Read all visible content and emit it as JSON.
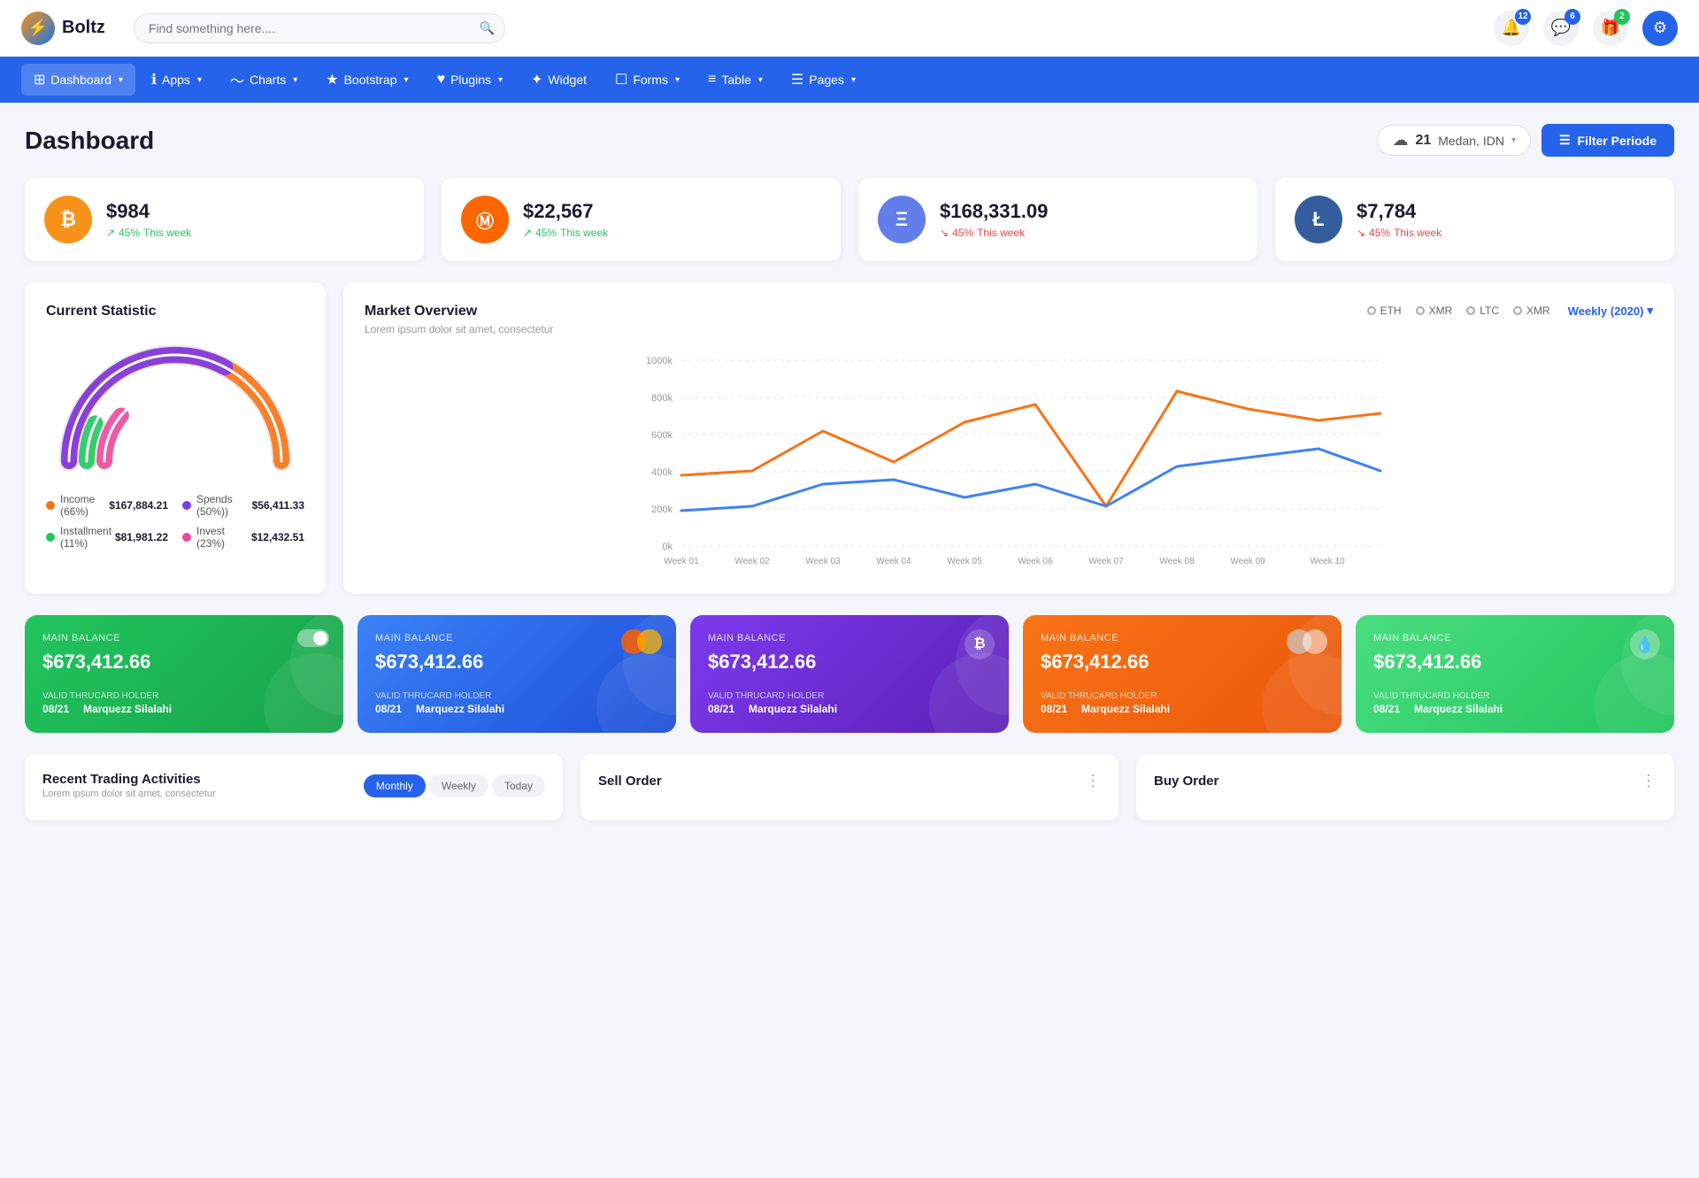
{
  "logo": {
    "text": "Boltz",
    "icon": "⚡"
  },
  "search": {
    "placeholder": "Find something here...."
  },
  "notifications": {
    "bell_count": "12",
    "message_count": "6",
    "gift_count": "2"
  },
  "nav": {
    "items": [
      {
        "id": "dashboard",
        "label": "Dashboard",
        "icon": "⊞",
        "hasArrow": true,
        "active": true
      },
      {
        "id": "apps",
        "label": "Apps",
        "icon": "ℹ",
        "hasArrow": true
      },
      {
        "id": "charts",
        "label": "Charts",
        "icon": "〜",
        "hasArrow": true
      },
      {
        "id": "bootstrap",
        "label": "Bootstrap",
        "icon": "★",
        "hasArrow": true
      },
      {
        "id": "plugins",
        "label": "Plugins",
        "icon": "♥",
        "hasArrow": true
      },
      {
        "id": "widget",
        "label": "Widget",
        "icon": "✦",
        "hasArrow": false
      },
      {
        "id": "forms",
        "label": "Forms",
        "icon": "☐",
        "hasArrow": true
      },
      {
        "id": "table",
        "label": "Table",
        "icon": "≡",
        "hasArrow": true
      },
      {
        "id": "pages",
        "label": "Pages",
        "icon": "☰",
        "hasArrow": true
      }
    ]
  },
  "dashboard": {
    "title": "Dashboard",
    "weather": {
      "icon": "☁",
      "temp": "21",
      "location": "Medan, IDN"
    },
    "filter_btn": "Filter Periode"
  },
  "stat_cards": [
    {
      "id": "btc",
      "icon": "₿",
      "icon_class": "btc",
      "value": "$984",
      "change": "45%",
      "period": "This week",
      "direction": "up"
    },
    {
      "id": "mono",
      "icon": "Ⓜ",
      "icon_class": "mono",
      "value": "$22,567",
      "change": "45%",
      "period": "This week",
      "direction": "up"
    },
    {
      "id": "eth",
      "icon": "Ξ",
      "icon_class": "eth",
      "value": "$168,331.09",
      "change": "45%",
      "period": "This week",
      "direction": "down"
    },
    {
      "id": "ltc",
      "icon": "Ł",
      "icon_class": "ltc",
      "value": "$7,784",
      "change": "45%",
      "period": "This week",
      "direction": "down"
    }
  ],
  "current_statistic": {
    "title": "Current Statistic",
    "legend": [
      {
        "color": "#f97316",
        "label": "Income (66%)",
        "value": "$167,884.21"
      },
      {
        "color": "#7c3aed",
        "label": "Spends (50%))",
        "value": "$56,411.33"
      },
      {
        "color": "#22c55e",
        "label": "Installment (11%)",
        "value": "$81,981.22"
      },
      {
        "color": "#ec4899",
        "label": "Invest (23%)",
        "value": "$12,432.51"
      }
    ]
  },
  "market_overview": {
    "title": "Market Overview",
    "subtitle": "Lorem ipsum dolor sit amet, consectetur",
    "legends": [
      "ETH",
      "XMR",
      "LTC",
      "XMR"
    ],
    "weekly_label": "Weekly (2020)",
    "y_labels": [
      "1000k",
      "800k",
      "600k",
      "400k",
      "200k",
      "0k"
    ],
    "x_labels": [
      "Week 01",
      "Week 02",
      "Week 03",
      "Week 04",
      "Week 05",
      "Week 06",
      "Week 07",
      "Week 08",
      "Week 09",
      "Week 10"
    ]
  },
  "balance_cards": [
    {
      "color_class": "green",
      "label": "Main Balance",
      "amount": "$673,412.66",
      "valid_label": "VALID THRUCARD HOLDER",
      "date": "08/21",
      "holder": "Marquezz Silalahi",
      "icon_type": "toggle"
    },
    {
      "color_class": "blue",
      "label": "Main Balance",
      "amount": "$673,412.66",
      "valid_label": "VALID THRUCARD HOLDER",
      "date": "08/21",
      "holder": "Marquezz Silalahi",
      "icon_type": "mastercard"
    },
    {
      "color_class": "purple",
      "label": "Main Balance",
      "amount": "$673,412.66",
      "valid_label": "VALID THRUCARD HOLDER",
      "date": "08/21",
      "holder": "Marquezz Silalahi",
      "icon_type": "btc"
    },
    {
      "color_class": "orange",
      "label": "Main Balance",
      "amount": "$673,412.66",
      "valid_label": "VALID THRUCARD HOLDER",
      "date": "08/21",
      "holder": "Marquezz Silalahi",
      "icon_type": "mastercard2"
    },
    {
      "color_class": "lgreen",
      "label": "Main Balance",
      "amount": "$673,412.66",
      "valid_label": "VALID THRUCARD HOLDER",
      "date": "08/21",
      "holder": "Marquezz Silalahi",
      "icon_type": "drop"
    }
  ],
  "recent_trading": {
    "title": "Recent Trading Activities",
    "subtitle": "Lorem ipsum dolor sit amet, consectetur",
    "tabs": [
      "Monthly",
      "Weekly",
      "Today"
    ],
    "active_tab": "Monthly"
  },
  "sell_order": {
    "title": "Sell Order"
  },
  "buy_order": {
    "title": "Buy Order"
  }
}
